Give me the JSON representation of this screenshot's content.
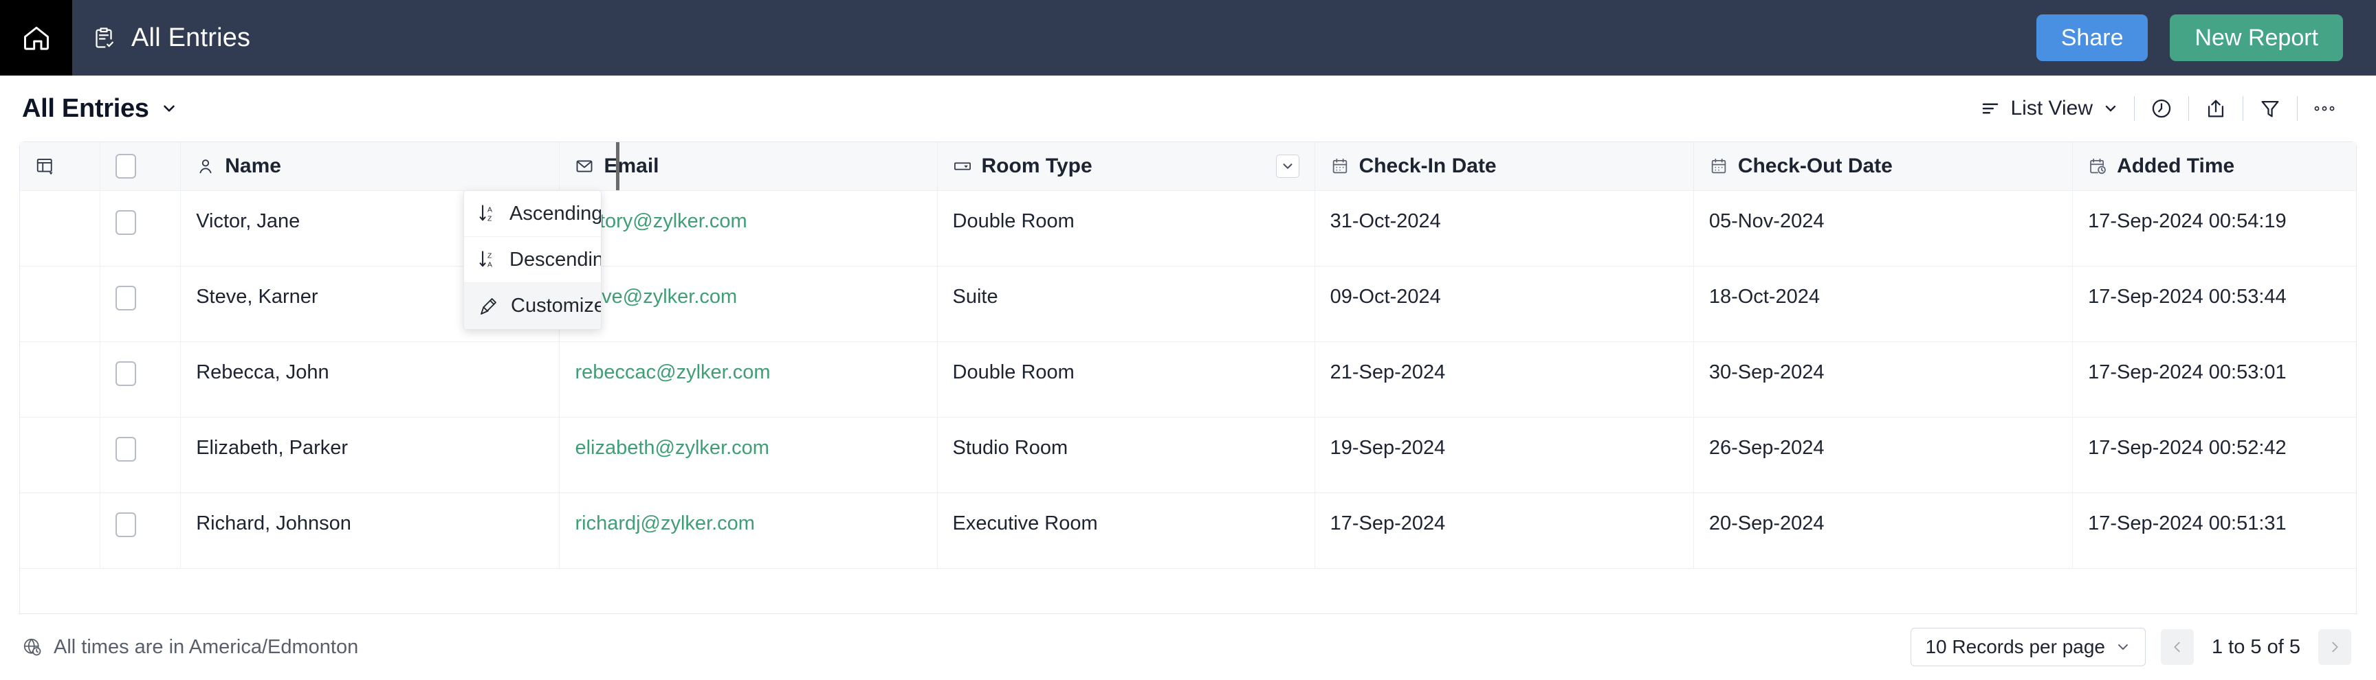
{
  "topbar": {
    "home_icon": "home-icon",
    "app_icon": "clipboard-check-icon",
    "title": "All Entries",
    "share_label": "Share",
    "new_report_label": "New Report",
    "bg_color": "#313b52",
    "share_color": "#4a90e2",
    "report_color": "#45a386"
  },
  "viewbar": {
    "view_name": "All Entries",
    "list_view_label": "List View",
    "icons": {
      "list": "list-view-icon",
      "chevron": "chevron-down-icon",
      "clock": "clock-icon",
      "export": "export-share-icon",
      "filter": "filter-funnel-icon",
      "more": "more-options-icon"
    }
  },
  "table": {
    "columns": [
      {
        "key": "settings",
        "label": "",
        "icon": "column-settings-icon"
      },
      {
        "key": "select",
        "label": "",
        "icon": "checkbox-icon"
      },
      {
        "key": "name",
        "label": "Name",
        "icon": "person-icon"
      },
      {
        "key": "email",
        "label": "Email",
        "icon": "envelope-icon"
      },
      {
        "key": "room_type",
        "label": "Room Type",
        "icon": "dropdown-field-icon"
      },
      {
        "key": "check_in",
        "label": "Check-In Date",
        "icon": "calendar-icon"
      },
      {
        "key": "check_out",
        "label": "Check-Out Date",
        "icon": "calendar-icon"
      },
      {
        "key": "added_time",
        "label": "Added Time",
        "icon": "calendar-clock-icon"
      }
    ],
    "rows": [
      {
        "name": "Victor, Jane",
        "email": "victory@zylker.com",
        "room_type": "Double Room",
        "check_in": "31-Oct-2024",
        "check_out": "05-Nov-2024",
        "added_time": "17-Sep-2024 00:54:19"
      },
      {
        "name": "Steve, Karner",
        "email": "steve@zylker.com",
        "room_type": "Suite",
        "check_in": "09-Oct-2024",
        "check_out": "18-Oct-2024",
        "added_time": "17-Sep-2024 00:53:44"
      },
      {
        "name": "Rebecca, John",
        "email": "rebeccac@zylker.com",
        "room_type": "Double Room",
        "check_in": "21-Sep-2024",
        "check_out": "30-Sep-2024",
        "added_time": "17-Sep-2024 00:53:01"
      },
      {
        "name": "Elizabeth, Parker",
        "email": "elizabeth@zylker.com",
        "room_type": "Studio Room",
        "check_in": "19-Sep-2024",
        "check_out": "26-Sep-2024",
        "added_time": "17-Sep-2024 00:52:42"
      },
      {
        "name": "Richard, Johnson",
        "email": "richardj@zylker.com",
        "room_type": "Executive Room",
        "check_in": "17-Sep-2024",
        "check_out": "20-Sep-2024",
        "added_time": "17-Sep-2024 00:51:31"
      }
    ],
    "email_link_color": "#3f9e76"
  },
  "sort_menu": {
    "open_for_column": "Room Type",
    "items": [
      {
        "label": "Ascending",
        "icon": "sort-az-icon",
        "active": false
      },
      {
        "label": "Descending",
        "icon": "sort-za-icon",
        "active": false
      },
      {
        "label": "Customize",
        "icon": "paintbrush-icon",
        "active": true
      }
    ]
  },
  "footer": {
    "timezone_note": "All times are in America/Edmonton",
    "timezone_icon": "globe-clock-icon",
    "records_per_page": "10 Records per page",
    "range_label": "1 to 5 of 5",
    "prev_icon": "chevron-left-icon",
    "next_icon": "chevron-right-icon"
  }
}
